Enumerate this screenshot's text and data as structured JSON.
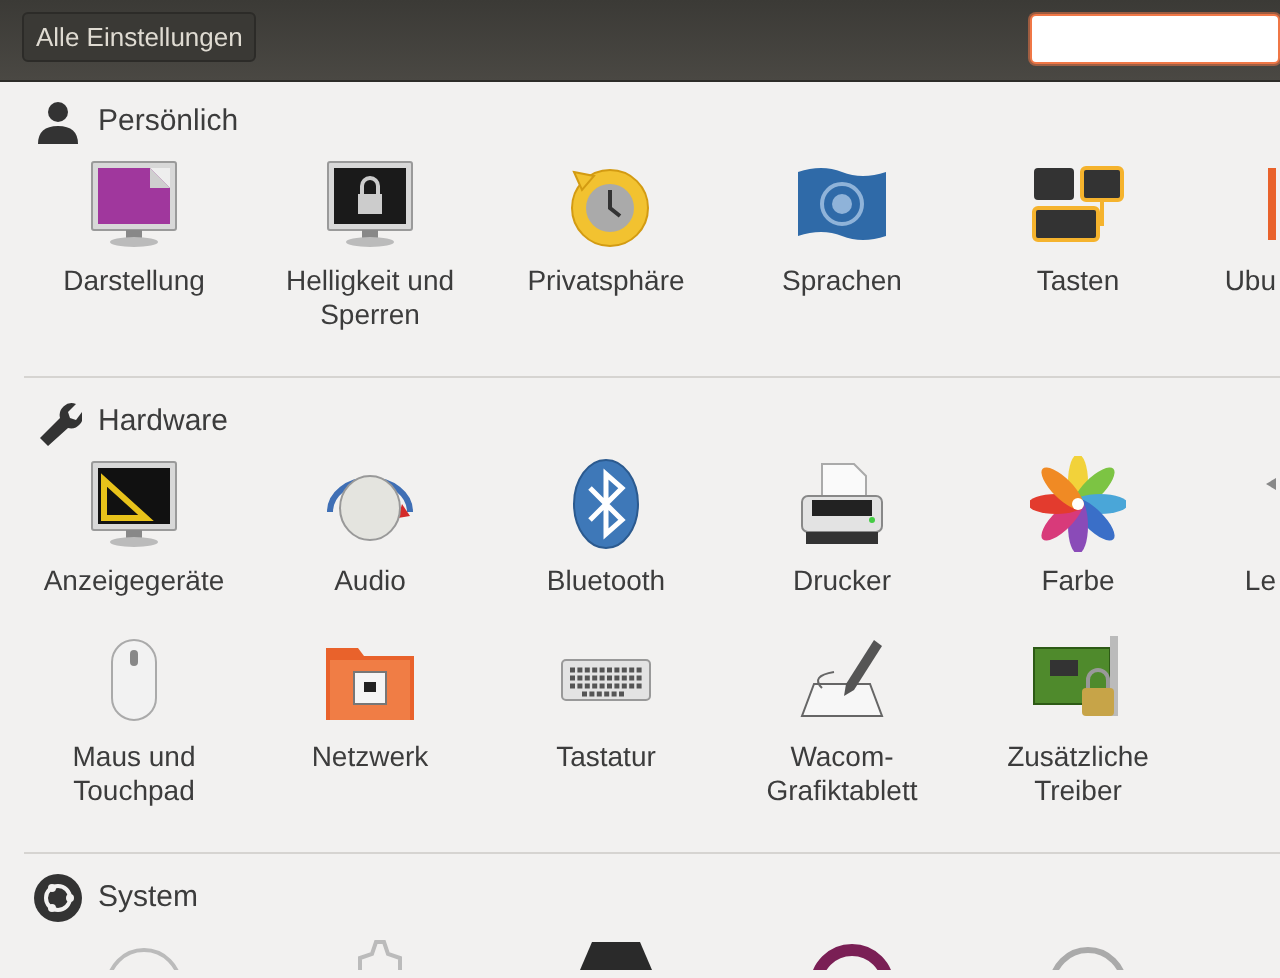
{
  "toolbar": {
    "all_settings_button": "Alle Einstellungen",
    "search": {
      "focused": true
    }
  },
  "sections": [
    {
      "title": "Persönlich",
      "items": [
        {
          "label": "Darstellung"
        },
        {
          "label": "Helligkeit und Sperren"
        },
        {
          "label": "Privatsphäre"
        },
        {
          "label": "Sprachen"
        },
        {
          "label": "Tasten"
        },
        {
          "label": "Ubu"
        }
      ]
    },
    {
      "title": "Hardware",
      "items": [
        {
          "label": "Anzeigegeräte"
        },
        {
          "label": "Audio"
        },
        {
          "label": "Bluetooth"
        },
        {
          "label": "Drucker"
        },
        {
          "label": "Farbe"
        },
        {
          "label": "Le"
        },
        {
          "label": "Maus und Touchpad"
        },
        {
          "label": "Netzwerk"
        },
        {
          "label": "Tastatur"
        },
        {
          "label": "Wacom-Grafiktablett"
        },
        {
          "label": "Zusätzliche Treiber"
        }
      ]
    },
    {
      "title": "System"
    }
  ]
}
